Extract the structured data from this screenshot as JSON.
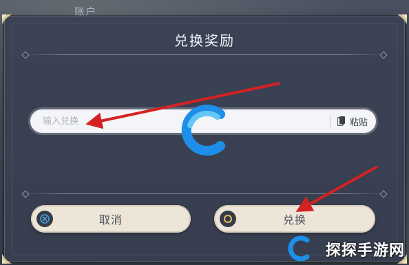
{
  "background": {
    "label": "账户"
  },
  "dialog": {
    "title": "兑换奖励",
    "input": {
      "placeholder": "输入兑换",
      "value": ""
    },
    "paste_label": "粘贴",
    "cancel_label": "取消",
    "confirm_label": "兑换"
  },
  "watermark": {
    "site_text": "探探手游网"
  },
  "colors": {
    "dialog_bg": "#3b4254",
    "button_bg": "#ece5d8",
    "arrow": "#d42222",
    "logo_blue": "#1e8fe8",
    "logo_light": "#63c8f5"
  },
  "icons": {
    "paste": "clipboard-icon",
    "cancel": "x-icon",
    "confirm": "circle-icon",
    "corner": "ornament-icon"
  }
}
